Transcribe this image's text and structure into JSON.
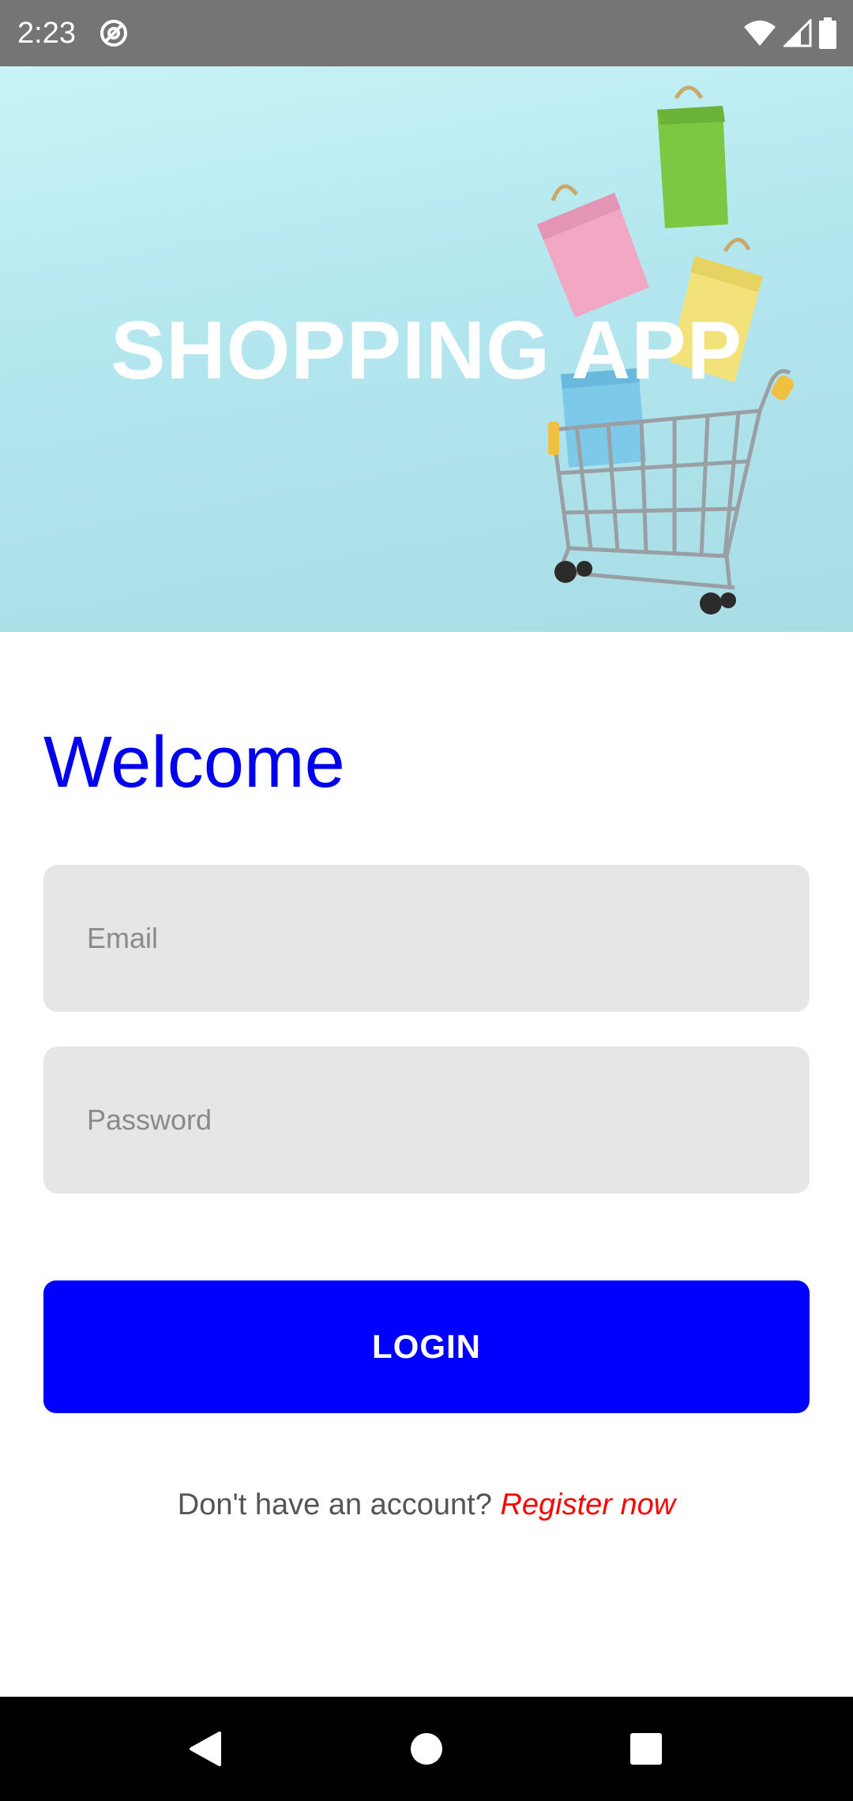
{
  "status_bar": {
    "time": "2:23",
    "sync_icon": "at-sync-icon",
    "wifi_icon": "wifi-icon",
    "signal_icon": "cell-signal-icon",
    "battery_icon": "battery-icon"
  },
  "hero": {
    "title": "SHOPPING APP",
    "background_color": "#b3e6ee"
  },
  "form": {
    "heading": "Welcome",
    "email_placeholder": "Email",
    "password_placeholder": "Password",
    "login_label": "LOGIN",
    "register_prompt": "Don't have an account?",
    "register_link": "Register now"
  },
  "colors": {
    "accent": "#0000ff",
    "heading": "#0000ee",
    "link": "#ff0000",
    "field_bg": "#e6e6e6"
  },
  "nav_bar": {
    "back_icon": "back-triangle-icon",
    "home_icon": "home-circle-icon",
    "recent_icon": "recents-square-icon"
  }
}
